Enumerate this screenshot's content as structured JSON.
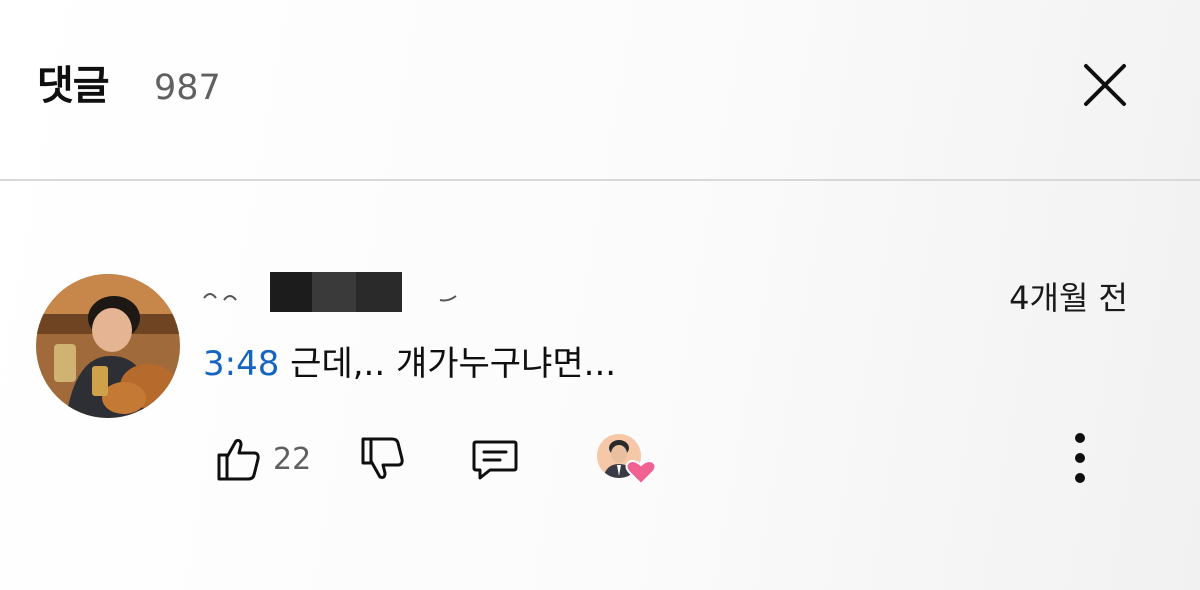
{
  "header": {
    "title": "댓글",
    "count": "987"
  },
  "comment": {
    "time_ago": "4개월 전",
    "timestamp": "3:48",
    "text": " 근데,.. 걔가누구냐면...",
    "like_count": "22"
  },
  "colors": {
    "timestamp_link": "#1565c0",
    "heart": "#f06292"
  },
  "icons": [
    "close-icon",
    "thumbs-up-icon",
    "thumbs-down-icon",
    "reply-icon",
    "creator-heart-icon",
    "more-vert-icon"
  ]
}
